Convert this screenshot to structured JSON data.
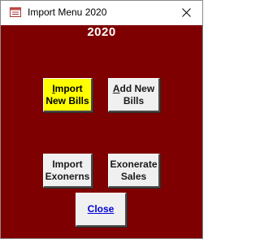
{
  "window": {
    "title": "Import Menu 2020",
    "close_glyph": "✕"
  },
  "form": {
    "year_label": "2020"
  },
  "buttons": {
    "import_new_bills": {
      "line1_accel": "I",
      "line1_rest": "mport",
      "line2": "New Bills",
      "color": "#ffff00"
    },
    "add_new_bills": {
      "line1_accel": "A",
      "line1_rest": "dd New",
      "line2": "Bills"
    },
    "import_exonerns": {
      "line1": "Import",
      "line2": "Exonerns"
    },
    "exonerate_sales": {
      "line1": "Exonerate",
      "line2": "Sales"
    },
    "close": {
      "accel": "C",
      "rest": "lose",
      "color": "#0000d8"
    }
  },
  "colors": {
    "form_background": "#7f0000",
    "button_face": "#f0f0f0"
  }
}
